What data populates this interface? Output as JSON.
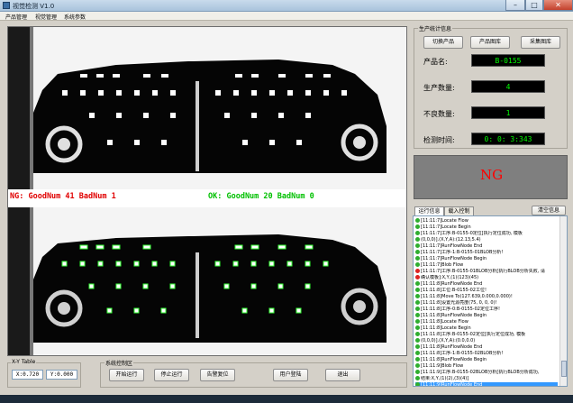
{
  "window": {
    "title": "视觉检测 V1.0",
    "minimize": "–",
    "maximize": "□",
    "close": "✕"
  },
  "menu": [
    "产品管理",
    "视觉管理",
    "系统参数"
  ],
  "overlay": {
    "ng_text": "NG: GoodNum 41 BadNum 1",
    "ok_text": "OK: GoodNum 20 BadNum 0"
  },
  "stats": {
    "group_title": "生产统计信息",
    "buttons": [
      "切换产品",
      "产品图库",
      "采集图库"
    ],
    "rows": [
      {
        "label": "产品名:",
        "value": "B-0155"
      },
      {
        "label": "生产数量:",
        "value": "4"
      },
      {
        "label": "不良数量:",
        "value": "1"
      },
      {
        "label": "检测时间:",
        "value": "0: 0: 3:343"
      }
    ]
  },
  "result": {
    "text": "NG"
  },
  "tabs": {
    "run_info": "运行信息",
    "load_info": "载入控制",
    "clear_button": "清空信息"
  },
  "log": [
    {
      "text": "[11:11:7]Locate Flow",
      "err": false
    },
    {
      "text": "[11:11:7]Locate Begin",
      "err": false
    },
    {
      "text": "[11:11:7]工序:B-0155-0定位[执行定位成功, 模板",
      "err": false
    },
    {
      "text": "(0,0,0)].(X,Y,A):(12.13,5.4)",
      "err": false
    },
    {
      "text": "[11:11:7]RunFlowNode End",
      "err": false
    },
    {
      "text": "[11:11:7]工序-1:B-0155-01BLOB分析!",
      "err": false
    },
    {
      "text": "[11:11:7]RunFlowNode Begin",
      "err": false
    },
    {
      "text": "[11:11:7]Blob Flow",
      "err": false
    },
    {
      "text": "[11:11:7]工序:B-0155-01BLOB分析[执行BLOB分析失败, 请",
      "err": true
    },
    {
      "text": "确认模板]:X,Y,(1)(123)(45)",
      "err": true
    },
    {
      "text": "[11:11:8]RunFlowNode End",
      "err": false
    },
    {
      "text": "[11:11:8]工位:B-0155-02工位!",
      "err": false
    },
    {
      "text": "[11:11:8]Move To(127.639,0.000,0.000)!",
      "err": false
    },
    {
      "text": "[11:11:8]设置光源亮度(75, 0, 0, 0)!",
      "err": false
    },
    {
      "text": "[11:11:8]工序-0:B-0155-02定位工序!",
      "err": false
    },
    {
      "text": "[11:11:8]RunFlowNode Begin",
      "err": false
    },
    {
      "text": "[11:11:8]Locate Flow",
      "err": false
    },
    {
      "text": "[11:11:8]Locate Begin",
      "err": false
    },
    {
      "text": "[11:11:8]工序:B-0155-02定位[执行定位成功, 模板",
      "err": false
    },
    {
      "text": "(0,0,0)].(X,Y,A):(0.0,0.0)",
      "err": false
    },
    {
      "text": "[11:11:8]RunFlowNode End",
      "err": false
    },
    {
      "text": "[11:11:8]工序-1:B-0155-02BLOB分析!",
      "err": false
    },
    {
      "text": "[11:11:8]RunFlowNode Begin",
      "err": false
    },
    {
      "text": "[11:11:9]Blob Flow",
      "err": false
    },
    {
      "text": "[11:11:9]工序:B-0155-02BLOB分析[执行BLOB分析成功,",
      "err": false
    },
    {
      "text": "结果:X,Y,(1)(2),(3)(4)]",
      "err": false
    },
    {
      "text": "[11:11:9]RunFlowNode End",
      "err": false,
      "selected": true
    }
  ],
  "xy": {
    "title": "X-Y Table",
    "x": "X:0.720",
    "y": "Y:0.000"
  },
  "control": {
    "title": "系统控制区",
    "buttons": [
      "开始运行",
      "停止运行",
      "告警复位",
      "用户登陆",
      "退出"
    ]
  },
  "colors": {
    "ng": "#e00000",
    "ok": "#00c000",
    "value_fg": "#00ff00",
    "result_bg": "#7f7f7f"
  }
}
